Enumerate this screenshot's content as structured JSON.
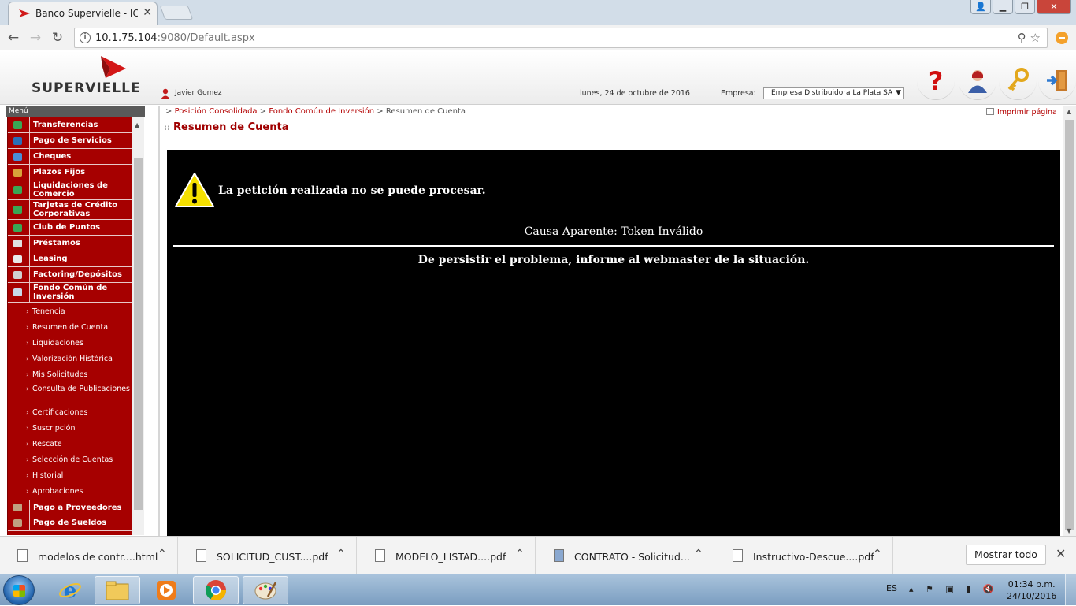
{
  "browser": {
    "tab_title": "Banco Supervielle - IC-Ba",
    "url_host": "10.1.75.104",
    "url_rest": ":9080/Default.aspx"
  },
  "header": {
    "logo_text": "SUPERVIELLE",
    "user_name": "Javier Gomez",
    "date": "lunes, 24 de octubre de 2016",
    "empresa_label": "Empresa:",
    "empresa_value": "Empresa Distribuidora La Plata SA",
    "icons": [
      "help-icon",
      "support-agent-icon",
      "key-icon",
      "logout-door-icon"
    ]
  },
  "menu": {
    "label": "Menú",
    "items": [
      {
        "label": "Transferencias",
        "icon": "transfer-icon",
        "color": "#3aa655"
      },
      {
        "label": "Pago de Servicios",
        "icon": "services-icon",
        "color": "#2a6fb8"
      },
      {
        "label": "Cheques",
        "icon": "cheque-icon",
        "color": "#4a8ed6"
      },
      {
        "label": "Plazos Fijos",
        "icon": "fixed-term-icon",
        "color": "#d8a23a"
      },
      {
        "label": "Liquidaciones de Comercio",
        "icon": "merchant-icon",
        "color": "#3aa655"
      },
      {
        "label": "Tarjetas de Crédito Corporativas",
        "icon": "credit-card-icon",
        "color": "#3aa655"
      },
      {
        "label": "Club de Puntos",
        "icon": "points-icon",
        "color": "#3aa655"
      },
      {
        "label": "Préstamos",
        "icon": "loan-icon",
        "color": "#e0e0e0"
      },
      {
        "label": "Leasing",
        "icon": "leasing-icon",
        "color": "#e8e8e8"
      },
      {
        "label": "Factoring/Depósitos",
        "icon": "factoring-icon",
        "color": "#d0d0d0"
      },
      {
        "label": "Fondo Común de Inversión",
        "icon": "fund-icon",
        "color": "#c8d8e8"
      }
    ],
    "sub_items": [
      "Tenencia",
      "Resumen de Cuenta",
      "Liquidaciones",
      "Valorización Histórica",
      "Mis Solicitudes",
      "Consulta de Publicaciones",
      "Certificaciones",
      "Suscripción",
      "Rescate",
      "Selección de Cuentas",
      "Historial",
      "Aprobaciones"
    ],
    "bottom_items": [
      {
        "label": "Pago a Proveedores",
        "icon": "suppliers-icon",
        "color": "#c0a080"
      },
      {
        "label": "Pago de Sueldos",
        "icon": "salary-icon",
        "color": "#c0a080"
      }
    ]
  },
  "content": {
    "breadcrumb": {
      "sep": ">",
      "link1": "Posición Consolidada",
      "link2": "Fondo Común de Inversión",
      "current": "Resumen de Cuenta"
    },
    "print_label": "Imprimir página",
    "page_title": "Resumen de Cuenta",
    "error": {
      "message": "La petición realizada no se puede procesar.",
      "cause": "Causa Aparente: Token Inválido",
      "persist": "De persistir el problema, informe al webmaster de la situación."
    }
  },
  "downloads": {
    "items": [
      {
        "name": "modelos de contr....html"
      },
      {
        "name": "SOLICITUD_CUST....pdf"
      },
      {
        "name": "MODELO_LISTAD....pdf"
      },
      {
        "name": "CONTRATO - Solicitud..."
      },
      {
        "name": "Instructivo-Descue....pdf"
      }
    ],
    "show_all": "Mostrar todo"
  },
  "taskbar": {
    "lang": "ES",
    "time": "01:34 p.m.",
    "date": "24/10/2016"
  },
  "colors": {
    "brand_red": "#a60000",
    "link_red": "#b30000",
    "error_bg": "#000000"
  }
}
